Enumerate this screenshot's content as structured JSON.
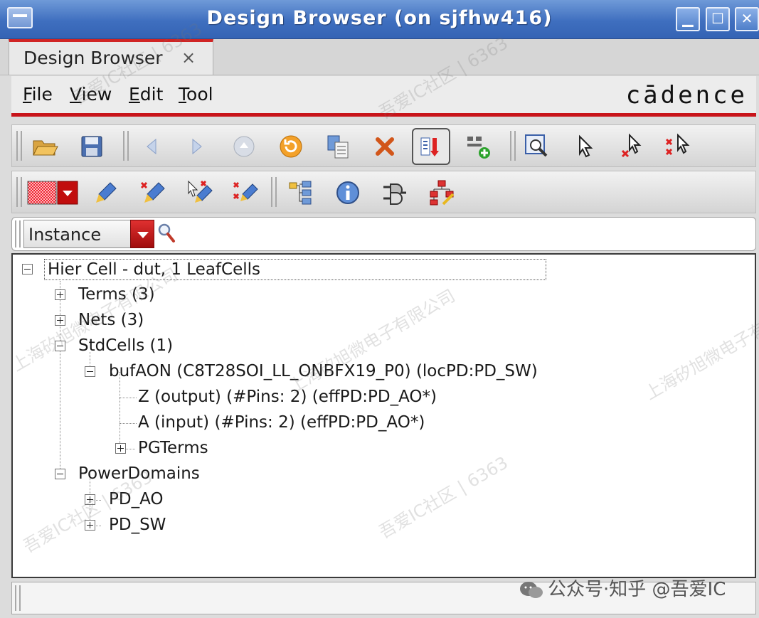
{
  "window": {
    "title": "Design Browser (on sjfhw416)"
  },
  "tab": {
    "label": "Design Browser",
    "close": "×"
  },
  "menu": {
    "items": [
      {
        "first": "F",
        "rest": "ile"
      },
      {
        "first": "V",
        "rest": "iew"
      },
      {
        "first": "E",
        "rest": "dit"
      },
      {
        "first": "T",
        "rest": "ool"
      }
    ],
    "logo": "cādence"
  },
  "search": {
    "type_value": "Instance",
    "query": ""
  },
  "tree": {
    "root": "Hier Cell - dut, 1 LeafCells",
    "terms": "Terms (3)",
    "nets": "Nets (3)",
    "stdcells": "StdCells (1)",
    "bufaon": "bufAON (C8T28SOI_LL_ONBFX19_P0) (locPD:PD_SW)",
    "pin_z": "Z (output) (#Pins: 2) (effPD:PD_AO*)",
    "pin_a": "A (input) (#Pins: 2) (effPD:PD_AO*)",
    "pgterms": "PGTerms",
    "powerdomains": "PowerDomains",
    "pd_ao": "PD_AO",
    "pd_sw": "PD_SW"
  },
  "watermarks": {
    "a": "吾爱IC社区 | 6363",
    "b": "上海矽旭微电子有限公司",
    "zhihu": "公众号·知乎 @吾爱IC"
  },
  "colors": {
    "titlebar": "#3f6fbf",
    "accent_red": "#c8141a"
  },
  "toolbar_icons": {
    "row1": [
      "open-folder-icon",
      "save-icon",
      "back-icon",
      "forward-icon",
      "stop-icon",
      "refresh-icon",
      "copy-list-icon",
      "delete-icon",
      "filter-icon",
      "add-item-icon",
      "zoom-fit-icon",
      "select-icon",
      "deselect-icon",
      "deselect-all-icon"
    ],
    "row2": [
      "color-swatch-icon",
      "highlight-icon",
      "dehighlight-icon",
      "dehighlight-select-icon",
      "dehighlight-all-icon",
      "hierarchy-icon",
      "info-icon",
      "connect-icon",
      "tree-edit-icon"
    ]
  }
}
